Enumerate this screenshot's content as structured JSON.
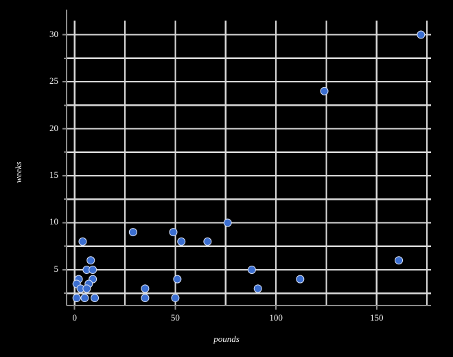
{
  "chart_data": {
    "type": "scatter",
    "title": "",
    "xlabel": "pounds",
    "ylabel": "weeks",
    "xlim": [
      -4,
      177
    ],
    "ylim": [
      1.2,
      31.5
    ],
    "xticks": [
      0,
      50,
      100,
      150
    ],
    "yticks": [
      5,
      10,
      15,
      20,
      25,
      30
    ],
    "xtick_labels": [
      "0",
      "50",
      "100",
      "150"
    ],
    "ytick_labels": [
      "5",
      "10",
      "15",
      "20",
      "25",
      "30"
    ],
    "x_major_gridlines": [
      0,
      25,
      50,
      75,
      100,
      125,
      150,
      175
    ],
    "y_major_gridlines": [
      2.5,
      5,
      7.5,
      10,
      12.5,
      15,
      17.5,
      20,
      22.5,
      25,
      27.5,
      30
    ],
    "grid": true,
    "legend": null,
    "background_color": "#000000",
    "grid_color": "#d9d9d9",
    "axis_color": "#8c8c8c",
    "text_color": "#f2f2f2",
    "marker_color": "#3b6ed0",
    "marker_edge_color": "#d9e2f5",
    "marker_size": 11,
    "points": [
      {
        "x": 172,
        "y": 30
      },
      {
        "x": 124,
        "y": 24
      },
      {
        "x": 76,
        "y": 10
      },
      {
        "x": 29,
        "y": 9
      },
      {
        "x": 49,
        "y": 9
      },
      {
        "x": 4,
        "y": 8
      },
      {
        "x": 53,
        "y": 8
      },
      {
        "x": 66,
        "y": 8
      },
      {
        "x": 161,
        "y": 6
      },
      {
        "x": 8,
        "y": 6
      },
      {
        "x": 88,
        "y": 5
      },
      {
        "x": 6,
        "y": 5
      },
      {
        "x": 9,
        "y": 5
      },
      {
        "x": 112,
        "y": 4
      },
      {
        "x": 51,
        "y": 4
      },
      {
        "x": 2,
        "y": 4
      },
      {
        "x": 9,
        "y": 4
      },
      {
        "x": 1,
        "y": 3.5
      },
      {
        "x": 7,
        "y": 3.5
      },
      {
        "x": 91,
        "y": 3
      },
      {
        "x": 35,
        "y": 3
      },
      {
        "x": 3,
        "y": 3
      },
      {
        "x": 6,
        "y": 3
      },
      {
        "x": 1,
        "y": 2
      },
      {
        "x": 5,
        "y": 2
      },
      {
        "x": 10,
        "y": 2
      },
      {
        "x": 35,
        "y": 2
      },
      {
        "x": 50,
        "y": 2
      }
    ]
  }
}
